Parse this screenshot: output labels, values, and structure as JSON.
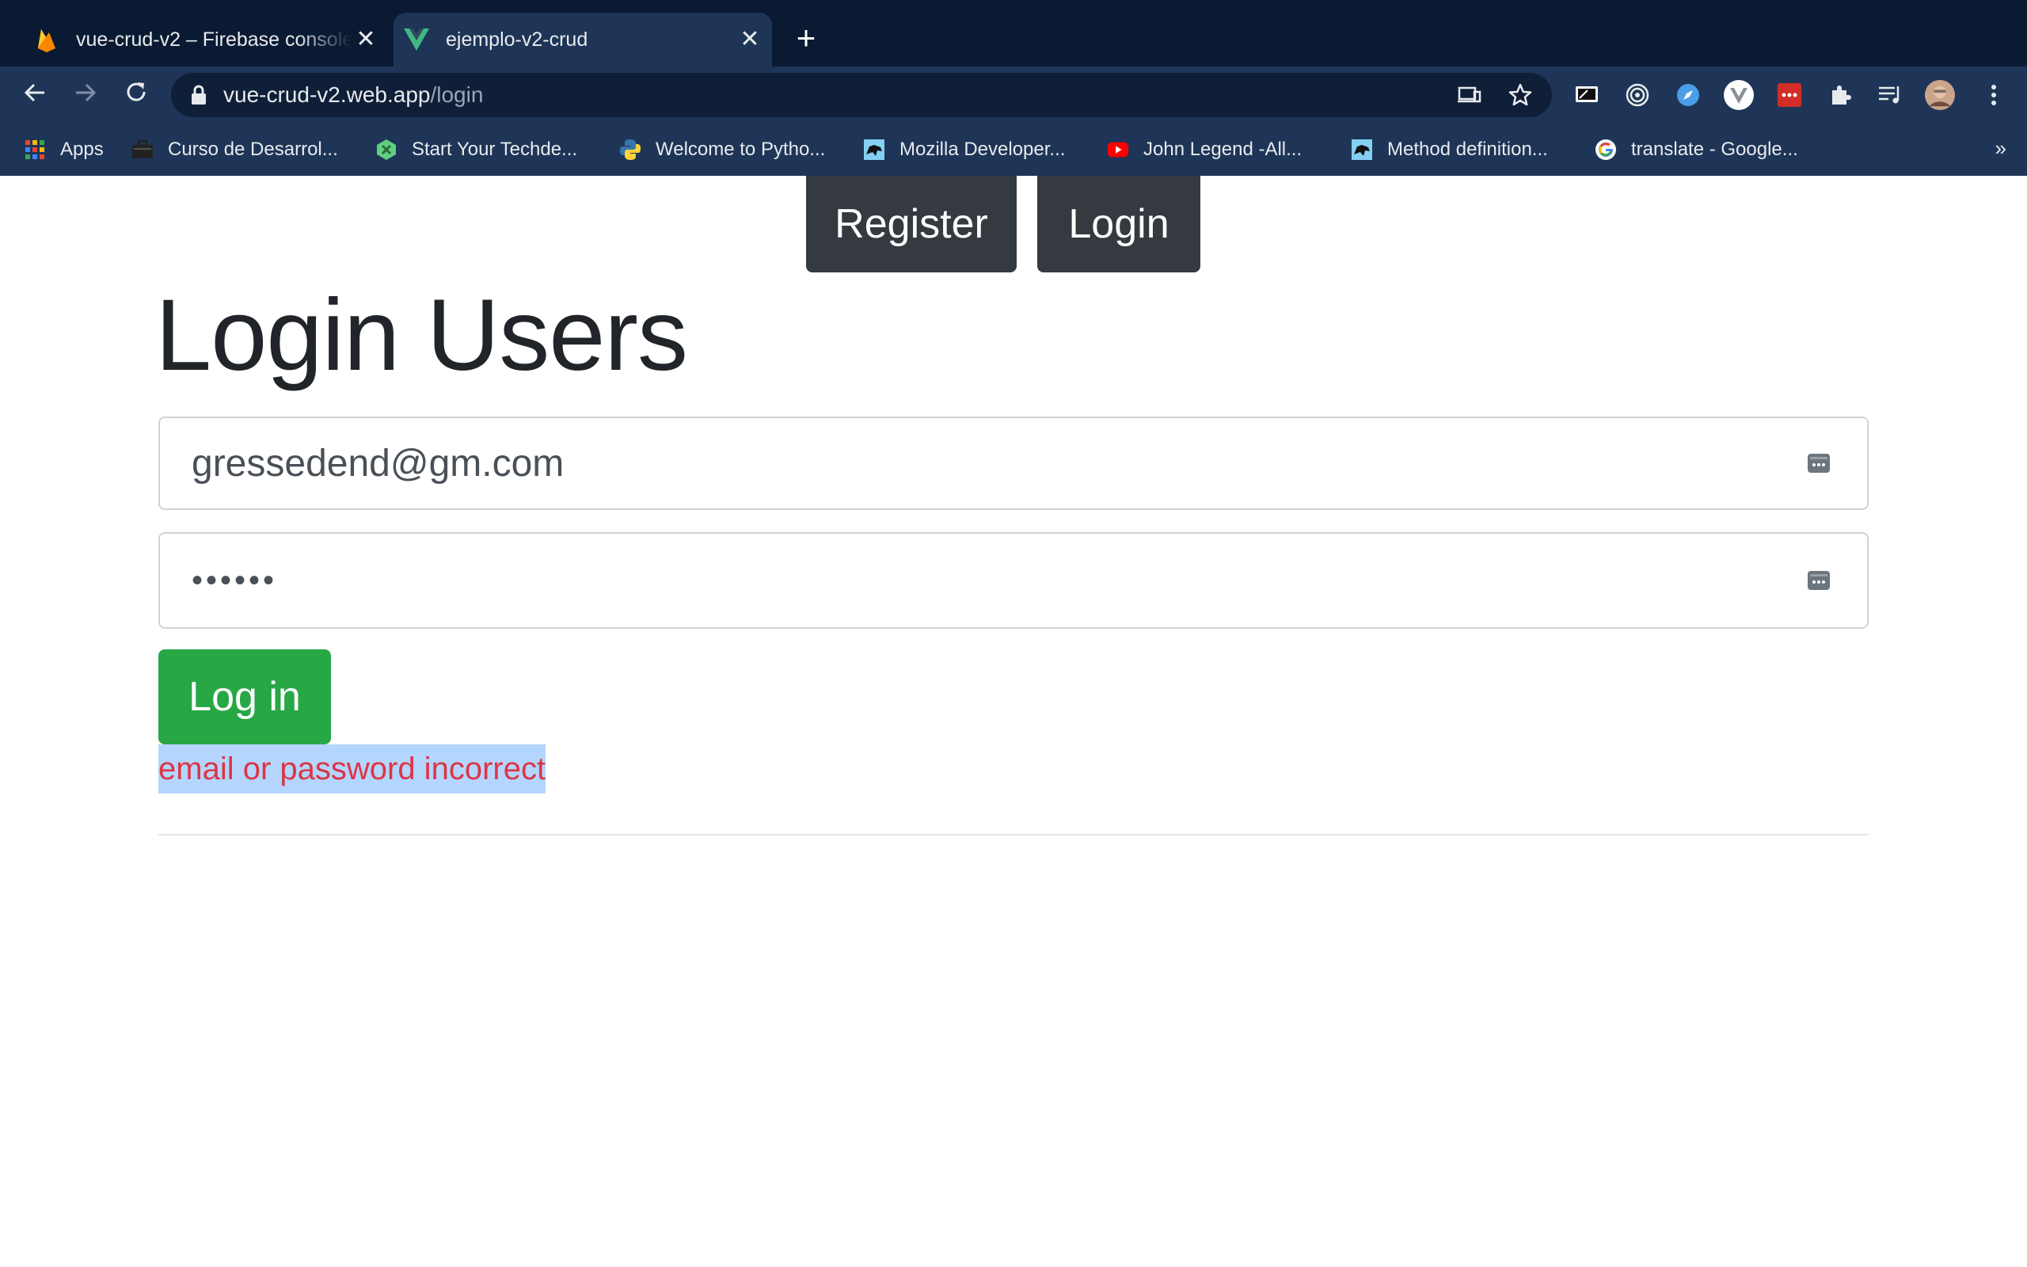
{
  "browser": {
    "tabs": [
      {
        "title": "vue-crud-v2 – Firebase console",
        "favicon": "firebase-icon",
        "active": false
      },
      {
        "title": "ejemplo-v2-crud",
        "favicon": "vue-icon",
        "active": true
      }
    ],
    "new_tab_label": "+",
    "close_label": "✕",
    "address": {
      "host": "vue-crud-v2.web.app",
      "path": "/login"
    },
    "bookmarks": [
      {
        "label": "Apps",
        "icon": "apps-grid-icon"
      },
      {
        "label": "Curso de Desarrol...",
        "icon": "briefcase-icon"
      },
      {
        "label": "Start Your Techde...",
        "icon": "techdegree-icon"
      },
      {
        "label": "Welcome to Pytho...",
        "icon": "python-icon"
      },
      {
        "label": "Mozilla Developer...",
        "icon": "mdn-icon"
      },
      {
        "label": "John Legend -All...",
        "icon": "youtube-icon"
      },
      {
        "label": "Method definition...",
        "icon": "mdn-icon"
      },
      {
        "label": "translate - Google...",
        "icon": "google-icon"
      }
    ],
    "bookmarks_overflow": "»",
    "colors": {
      "tabstrip": "#0b1a33",
      "toolbar": "#1e3557"
    }
  },
  "nav": {
    "register_label": "Register",
    "login_label": "Login"
  },
  "main": {
    "title": "Login Users",
    "email_value": "gressedend@gm.com",
    "password_mask": "••••••",
    "submit_label": "Log in",
    "error_message": "email or password incorrect"
  },
  "colors": {
    "nav_button": "#343a40",
    "submit_button": "#28a745",
    "error_text": "#dc3545",
    "selection_highlight": "#b4d5fe"
  }
}
